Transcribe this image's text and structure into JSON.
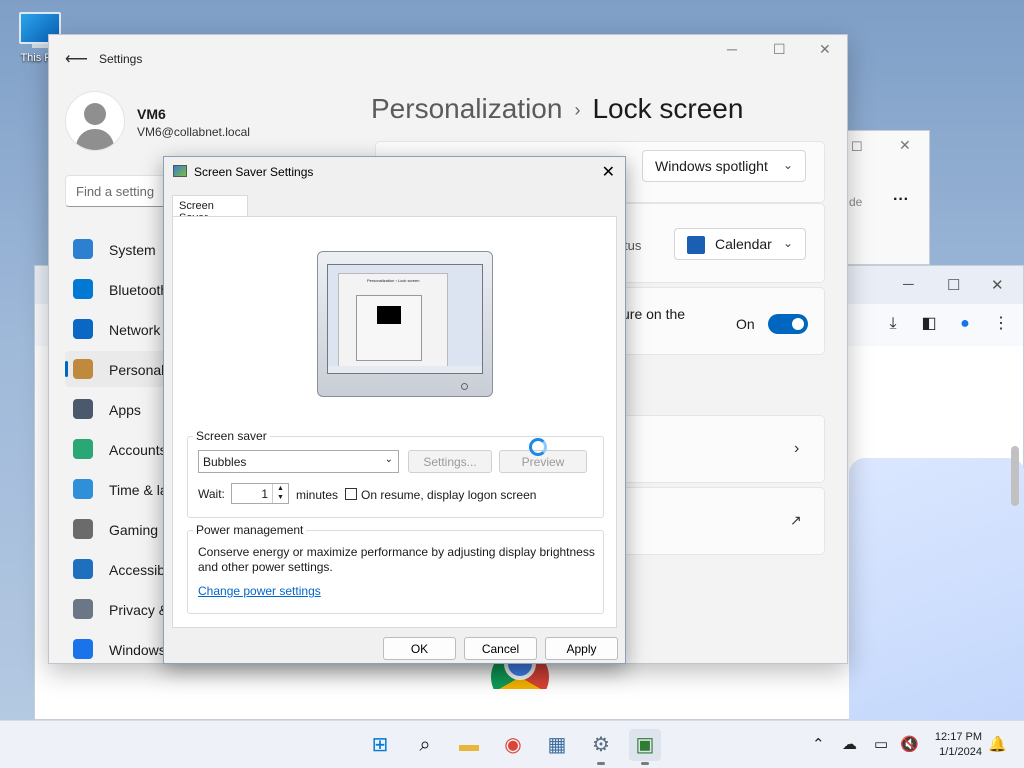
{
  "desktop": {
    "icon_label": "This PC"
  },
  "settings": {
    "app_title": "Settings",
    "user": {
      "name": "VM6",
      "email": "VM6@collabnet.local"
    },
    "search_placeholder": "Find a setting",
    "nav": [
      {
        "label": "System",
        "icon": "system-icon",
        "color": "#2d7fd2"
      },
      {
        "label": "Bluetooth",
        "icon": "bluetooth-icon",
        "color": "#0078d4"
      },
      {
        "label": "Network",
        "icon": "network-icon",
        "color": "#0a67c4"
      },
      {
        "label": "Personali",
        "icon": "brush-icon",
        "color": "#c08a3e"
      },
      {
        "label": "Apps",
        "icon": "apps-icon",
        "color": "#4a5a6c"
      },
      {
        "label": "Accounts",
        "icon": "accounts-icon",
        "color": "#2aa774"
      },
      {
        "label": "Time & la",
        "icon": "time-language-icon",
        "color": "#2f8fd8"
      },
      {
        "label": "Gaming",
        "icon": "gaming-icon",
        "color": "#6b6b6b"
      },
      {
        "label": "Accessibi",
        "icon": "accessibility-icon",
        "color": "#1f6fbf"
      },
      {
        "label": "Privacy &",
        "icon": "shield-icon",
        "color": "#6b7686"
      },
      {
        "label": "Windows",
        "icon": "update-icon",
        "color": "#1a73e8"
      }
    ],
    "breadcrumb": {
      "parent": "Personalization",
      "separator": "›",
      "current": "Lock screen"
    },
    "rows": {
      "lock_screen_combo": "Windows spotlight",
      "status_label": "tus",
      "status_combo": "Calendar",
      "signin_text": "ure on the",
      "toggle_label": "On",
      "toggle_on": 1
    }
  },
  "win2": {
    "text": "de"
  },
  "dialog": {
    "title": "Screen Saver Settings",
    "tab": "Screen Saver",
    "screen_saver_group": "Screen saver",
    "selected_saver": "Bubbles",
    "settings_button": "Settings...",
    "preview_button": "Preview",
    "wait_label": "Wait:",
    "wait_value": "1",
    "minutes_label": "minutes",
    "resume_label": "On resume, display logon screen",
    "resume_checked": 0,
    "power_group": "Power management",
    "power_text": "Conserve energy or maximize performance by adjusting display brightness and other power settings.",
    "power_link": "Change power settings",
    "ok": "OK",
    "cancel": "Cancel",
    "apply": "Apply",
    "preview_mini": {
      "crumb": "Personalization  ›  Lock screen"
    }
  },
  "taskbar": {
    "apps": [
      "windows-start-icon",
      "search-icon",
      "file-explorer-icon",
      "chrome-icon",
      "task-manager-icon",
      "settings-icon",
      "screen-saver-icon"
    ],
    "time": "12:17 PM",
    "date": "1/1/2024"
  }
}
